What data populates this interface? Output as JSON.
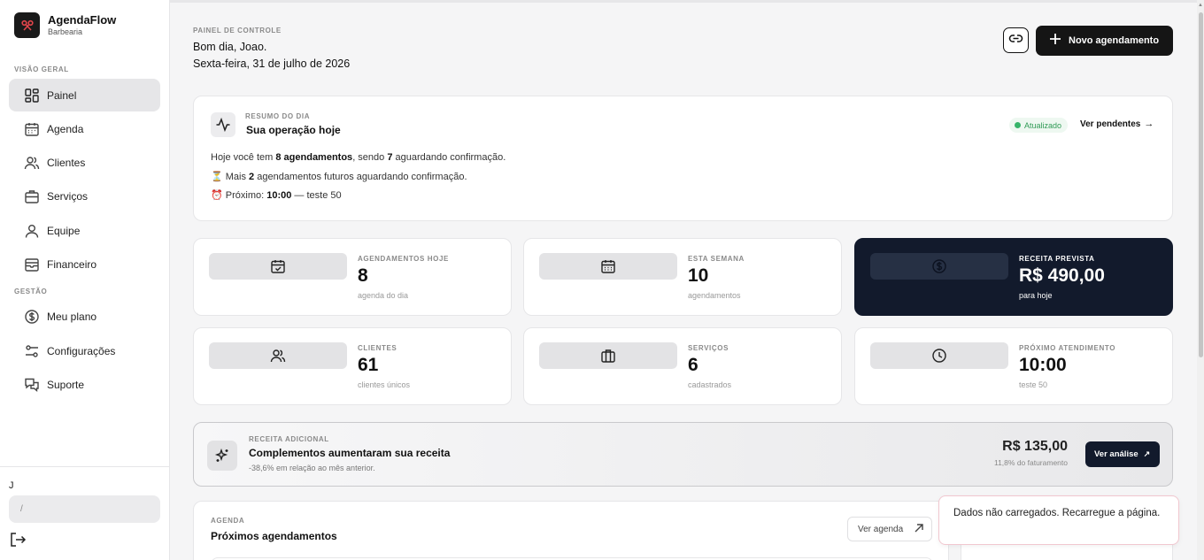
{
  "brand": {
    "name": "AgendaFlow",
    "subtitle": "Barbearia"
  },
  "sidebar": {
    "section_overview": "VISÃO GERAL",
    "section_management": "GESTÃO",
    "items": [
      {
        "label": "Painel",
        "icon": "grid-icon",
        "active": true
      },
      {
        "label": "Agenda",
        "icon": "calendar-icon"
      },
      {
        "label": "Clientes",
        "icon": "users-icon"
      },
      {
        "label": "Serviços",
        "icon": "briefcase-icon"
      },
      {
        "label": "Equipe",
        "icon": "user-icon"
      },
      {
        "label": "Financeiro",
        "icon": "wallet-icon"
      },
      {
        "label": "Meu plano",
        "icon": "dollar-circle-icon"
      },
      {
        "label": "Configurações",
        "icon": "sliders-icon"
      },
      {
        "label": "Suporte",
        "icon": "chat-icon"
      }
    ],
    "user_initial": "J",
    "user_box_text": "/"
  },
  "header": {
    "eyebrow": "PAINEL DE CONTROLE",
    "greeting": "Bom dia, Joao.",
    "date": "Sexta-feira, 31 de julho de 2026",
    "new_button": "Novo agendamento"
  },
  "summary": {
    "eyebrow": "RESUMO DO DIA",
    "title": "Sua operação hoje",
    "badge": "Atualizado",
    "pending_link": "Ver pendentes",
    "line1": {
      "a": "Hoje você tem ",
      "b": "8 agendamentos",
      "c": ", sendo ",
      "d": "7",
      "e": " aguardando confirmação."
    },
    "line2": {
      "emoji": "⏳",
      "a": " Mais ",
      "b": "2",
      "c": " agendamentos futuros aguardando confirmação."
    },
    "line3": {
      "emoji": "⏰",
      "a": " Próximo: ",
      "b": "10:00",
      "c": " — teste 50"
    }
  },
  "stats": [
    {
      "label": "AGENDAMENTOS HOJE",
      "value": "8",
      "sub": "agenda do dia",
      "icon": "calendar-check-icon"
    },
    {
      "label": "ESTA SEMANA",
      "value": "10",
      "sub": "agendamentos",
      "icon": "calendar-week-icon"
    },
    {
      "label": "RECEITA PREVISTA",
      "value": "R$ 490,00",
      "sub": "para hoje",
      "icon": "dollar-circle-icon"
    },
    {
      "label": "CLIENTES",
      "value": "61",
      "sub": "clientes únicos",
      "icon": "users-icon"
    },
    {
      "label": "SERVIÇOS",
      "value": "6",
      "sub": "cadastrados",
      "icon": "briefcase-icon"
    },
    {
      "label": "PRÓXIMO ATENDIMENTO",
      "value": "10:00",
      "sub": "teste 50",
      "icon": "clock-icon"
    }
  ],
  "extra": {
    "eyebrow": "RECEITA ADICIONAL",
    "title": "Complementos aumentaram sua receita",
    "desc": "-38,6% em relação ao mês anterior.",
    "amount": "R$ 135,00",
    "pct": "11,8% do faturamento",
    "button": "Ver análise"
  },
  "agenda": {
    "eyebrow": "AGENDA",
    "title": "Próximos agendamentos",
    "button": "Ver agenda"
  },
  "toast": {
    "message": "Dados não carregados. Recarregue a página."
  },
  "colors": {
    "dark_card": "#121a2c",
    "success": "#37b46a",
    "toast_border": "#f1c7cf"
  }
}
